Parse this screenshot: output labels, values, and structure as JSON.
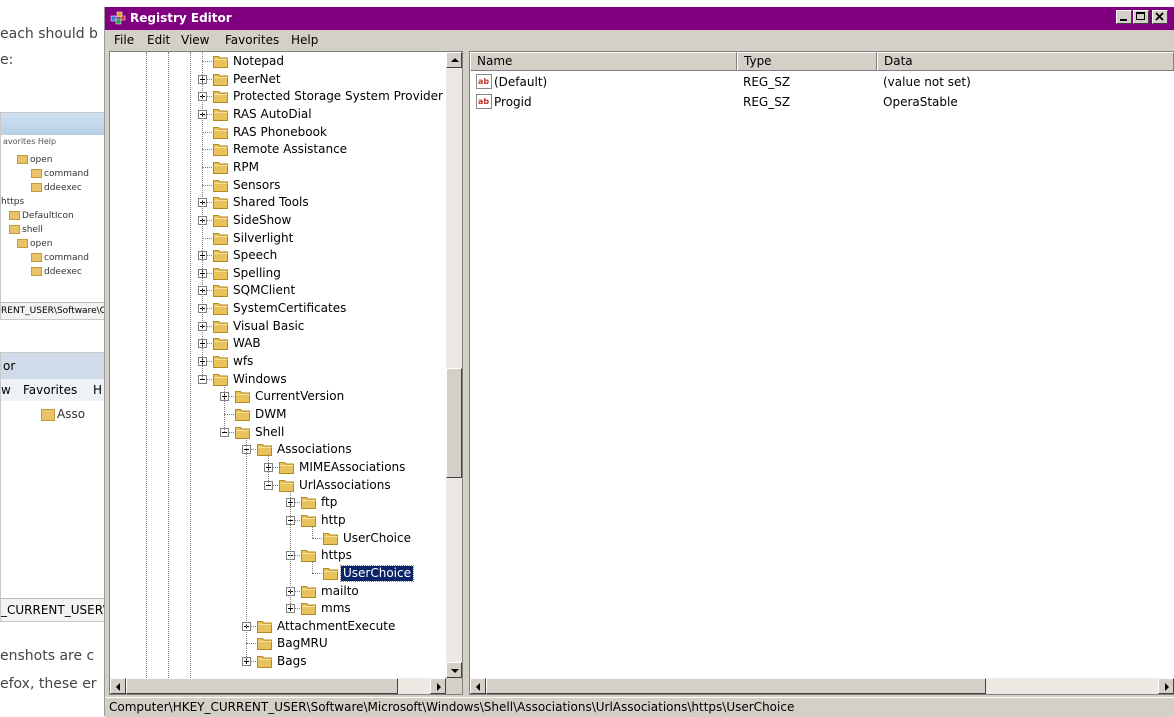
{
  "background": {
    "text_top_1": "each should b",
    "text_top_2": "e:",
    "text_bottom_1": "enshots are c",
    "text_bottom_2": "efox, these er",
    "thumb1": {
      "menu": "avorites   Help",
      "items": [
        "open",
        "command",
        "ddeexec",
        "https",
        "DefaultIcon",
        "shell",
        "open",
        "command",
        "ddeexec"
      ],
      "status": "RENT_USER\\Software\\C"
    },
    "thumb2": {
      "title": "or",
      "menu_view": "w",
      "menu_favorites": "Favorites",
      "menu_help": "H",
      "item": "Asso",
      "status": "_CURRENT_USER\\"
    }
  },
  "window": {
    "title": "Registry Editor",
    "titlebar_color": "#800080",
    "menus": [
      "File",
      "Edit",
      "View",
      "Favorites",
      "Help"
    ],
    "controls": [
      "minimize-button",
      "maximize-button",
      "close-button"
    ]
  },
  "tree": {
    "items": [
      {
        "label": "Notepad",
        "depth": 0,
        "expander": "none"
      },
      {
        "label": "PeerNet",
        "depth": 0,
        "expander": "plus"
      },
      {
        "label": "Protected Storage System Provider",
        "depth": 0,
        "expander": "plus"
      },
      {
        "label": "RAS AutoDial",
        "depth": 0,
        "expander": "plus"
      },
      {
        "label": "RAS Phonebook",
        "depth": 0,
        "expander": "none"
      },
      {
        "label": "Remote Assistance",
        "depth": 0,
        "expander": "none"
      },
      {
        "label": "RPM",
        "depth": 0,
        "expander": "none"
      },
      {
        "label": "Sensors",
        "depth": 0,
        "expander": "none"
      },
      {
        "label": "Shared Tools",
        "depth": 0,
        "expander": "plus"
      },
      {
        "label": "SideShow",
        "depth": 0,
        "expander": "plus"
      },
      {
        "label": "Silverlight",
        "depth": 0,
        "expander": "none"
      },
      {
        "label": "Speech",
        "depth": 0,
        "expander": "plus"
      },
      {
        "label": "Spelling",
        "depth": 0,
        "expander": "plus"
      },
      {
        "label": "SQMClient",
        "depth": 0,
        "expander": "plus"
      },
      {
        "label": "SystemCertificates",
        "depth": 0,
        "expander": "plus"
      },
      {
        "label": "Visual Basic",
        "depth": 0,
        "expander": "plus"
      },
      {
        "label": "WAB",
        "depth": 0,
        "expander": "plus"
      },
      {
        "label": "wfs",
        "depth": 0,
        "expander": "plus"
      },
      {
        "label": "Windows",
        "depth": 0,
        "expander": "minus"
      },
      {
        "label": "CurrentVersion",
        "depth": 1,
        "expander": "plus"
      },
      {
        "label": "DWM",
        "depth": 1,
        "expander": "none"
      },
      {
        "label": "Shell",
        "depth": 1,
        "expander": "minus"
      },
      {
        "label": "Associations",
        "depth": 2,
        "expander": "minus"
      },
      {
        "label": "MIMEAssociations",
        "depth": 3,
        "expander": "plus"
      },
      {
        "label": "UrlAssociations",
        "depth": 3,
        "expander": "minus"
      },
      {
        "label": "ftp",
        "depth": 4,
        "expander": "plus"
      },
      {
        "label": "http",
        "depth": 4,
        "expander": "minus"
      },
      {
        "label": "UserChoice",
        "depth": 5,
        "expander": "none"
      },
      {
        "label": "https",
        "depth": 4,
        "expander": "minus"
      },
      {
        "label": "UserChoice",
        "depth": 5,
        "expander": "none",
        "selected": true
      },
      {
        "label": "mailto",
        "depth": 4,
        "expander": "plus"
      },
      {
        "label": "mms",
        "depth": 4,
        "expander": "plus"
      },
      {
        "label": "AttachmentExecute",
        "depth": 2,
        "expander": "plus"
      },
      {
        "label": "BagMRU",
        "depth": 2,
        "expander": "none"
      },
      {
        "label": "Bags",
        "depth": 2,
        "expander": "plus"
      }
    ]
  },
  "list": {
    "columns": [
      "Name",
      "Type",
      "Data"
    ],
    "rows": [
      {
        "name": "(Default)",
        "type": "REG_SZ",
        "data": "(value not set)"
      },
      {
        "name": "Progid",
        "type": "REG_SZ",
        "data": "OperaStable"
      }
    ]
  },
  "statusbar": {
    "path": "Computer\\HKEY_CURRENT_USER\\Software\\Microsoft\\Windows\\Shell\\Associations\\UrlAssociations\\https\\UserChoice"
  },
  "icons": {
    "folder": "folder-icon",
    "registry_string": "reg-sz-icon",
    "app": "registry-editor-icon"
  },
  "colors": {
    "selection": "#0a246a",
    "folder": "#e9c25b",
    "chrome": "#d4d0c8"
  }
}
